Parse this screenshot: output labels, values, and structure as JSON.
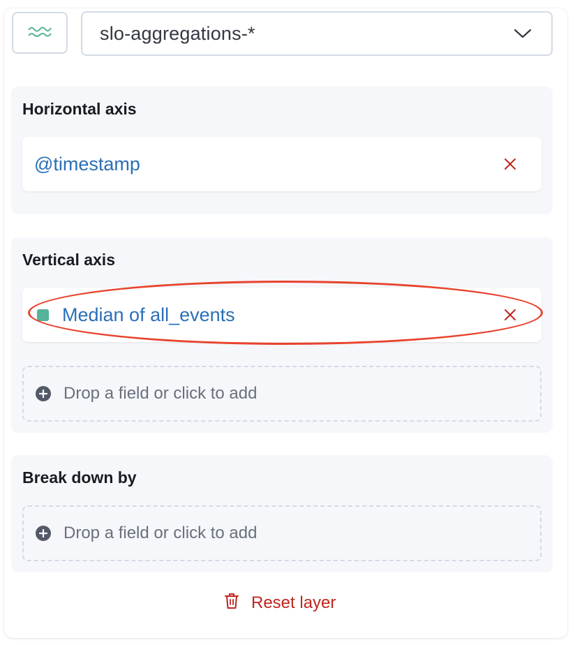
{
  "layer": {
    "chart_type_icon": "line-chart-icon",
    "index_pattern": "slo-aggregations-*",
    "dropdown_icon": "chevron-down-icon"
  },
  "horizontal_axis": {
    "title": "Horizontal axis",
    "field": "@timestamp"
  },
  "vertical_axis": {
    "title": "Vertical axis",
    "field": "Median of all_events",
    "swatch_color": "#54b399",
    "drop_label": "Drop a field or click to add"
  },
  "break_down_by": {
    "title": "Break down by",
    "drop_label": "Drop a field or click to add"
  },
  "reset": {
    "label": "Reset layer",
    "icon": "trash-icon"
  },
  "colors": {
    "link": "#2b6fb6",
    "danger": "#bd271e",
    "annotation": "#e8432e",
    "group_bg": "#f5f7fa"
  }
}
